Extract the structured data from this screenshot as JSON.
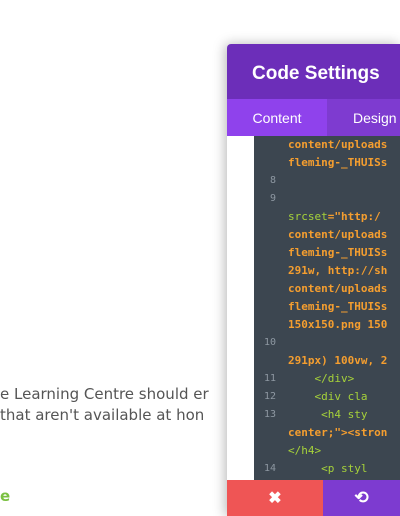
{
  "page": {
    "line1": "e Learning Centre should er",
    "line2": "that aren't available at hon",
    "link_fragment": "e"
  },
  "modal": {
    "title": "Code Settings",
    "tabs": [
      {
        "label": "Content",
        "active": true
      },
      {
        "label": "Design",
        "active": false
      }
    ],
    "code_lines": [
      {
        "num": "",
        "text": "content/uploads",
        "style": "str"
      },
      {
        "num": "",
        "text": "fleming-_THUISs",
        "style": "str"
      },
      {
        "num": "8",
        "text": "",
        "style": "plain"
      },
      {
        "num": "9",
        "text": "",
        "style": "plain"
      },
      {
        "num": "",
        "text": "srcset=\"http:/",
        "style": "attr-str"
      },
      {
        "num": "",
        "text": "content/uploads",
        "style": "str"
      },
      {
        "num": "",
        "text": "fleming-_THUISs",
        "style": "str"
      },
      {
        "num": "",
        "text": "291w, http://sh",
        "style": "str"
      },
      {
        "num": "",
        "text": "content/uploads",
        "style": "str"
      },
      {
        "num": "",
        "text": "fleming-_THUISs",
        "style": "str"
      },
      {
        "num": "",
        "text": "150x150.png 150",
        "style": "str"
      },
      {
        "num": "10",
        "text": "",
        "style": "plain"
      },
      {
        "num": "",
        "text": "291px) 100vw, 2",
        "style": "str"
      },
      {
        "num": "11",
        "text": "    </div>",
        "style": "tag"
      },
      {
        "num": "12",
        "text": "    <div cla",
        "style": "tag"
      },
      {
        "num": "13",
        "text": "     <h4 sty",
        "style": "tag"
      },
      {
        "num": "",
        "text": "center;\"><stron",
        "style": "str"
      },
      {
        "num": "",
        "text": "</h4>",
        "style": "tag"
      },
      {
        "num": "14",
        "text": "     <p styl",
        "style": "tag"
      },
      {
        "num": "",
        "text": "  \">Re",
        "style": "str"
      }
    ],
    "colors": {
      "header": "#6c2eb9",
      "tabs": "#7e3bd0",
      "active_tab": "#8f42ec",
      "editor_bg": "#3c4650",
      "string": "#f59e2f",
      "tag": "#a6d23a",
      "close_button": "#ef5555",
      "undo_button": "#7d3bd0",
      "link": "#7bc142"
    },
    "footer": {
      "close_icon": "close-icon",
      "close_glyph": "✖",
      "undo_icon": "undo-icon",
      "undo_glyph": "⟲"
    }
  }
}
